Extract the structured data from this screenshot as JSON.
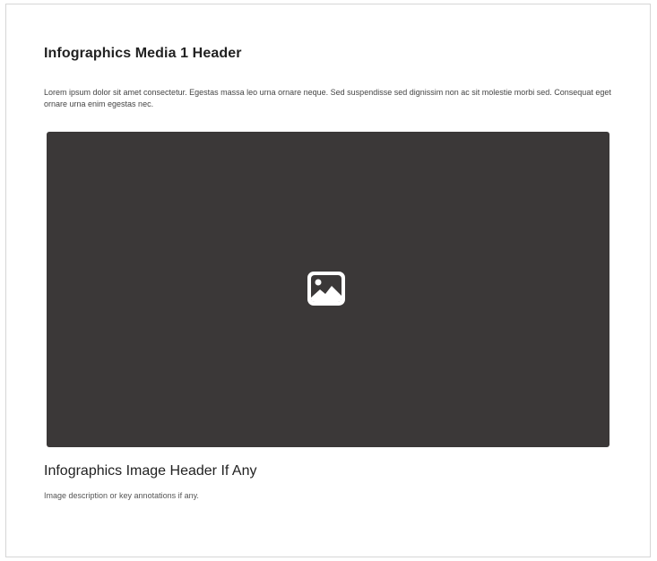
{
  "section": {
    "title": "Infographics Media 1 Header",
    "description": "Lorem ipsum dolor sit amet consectetur. Egestas massa leo urna ornare neque. Sed suspendisse sed dignissim non ac sit molestie morbi sed. Consequat eget ornare urna enim egestas nec."
  },
  "media": {
    "placeholder_icon": "image-placeholder-icon",
    "background_color": "#3b3838"
  },
  "image": {
    "title": "Infographics Image Header If Any",
    "caption": "Image description or key annotations if any."
  }
}
